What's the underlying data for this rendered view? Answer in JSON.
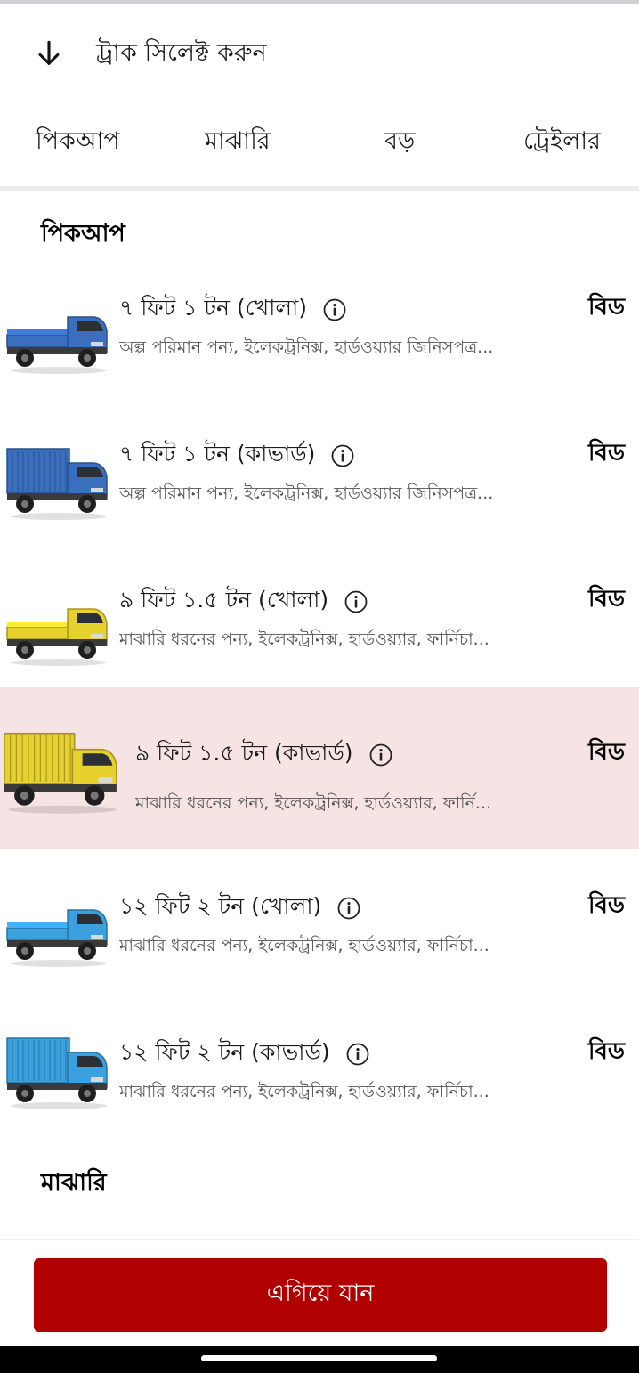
{
  "header": {
    "title": "ট্রাক সিলেক্ট করুন",
    "back_icon": "arrow-down-icon"
  },
  "tabs": [
    {
      "label": "পিকআপ",
      "active": true
    },
    {
      "label": "মাঝারি",
      "active": false
    },
    {
      "label": "বড়",
      "active": false
    },
    {
      "label": "ট্রেইলার",
      "active": false
    }
  ],
  "colors": {
    "accent": "#c8102e",
    "button": "#b00000",
    "selected_row": "#f6e4e4"
  },
  "sections": [
    {
      "title": "পিকআপ",
      "items": [
        {
          "title": "৭ ফিট ১ টন (খোলা)",
          "desc": "অল্প পরিমান পন্য, ইলেকট্রনিক্স, হার্ডওয়্যার জিনিসপত্র...",
          "action": "বিড",
          "truck_color": "#3a6fc0",
          "truck_type": "open",
          "selected": false
        },
        {
          "title": "৭ ফিট ১ টন (কাভার্ড)",
          "desc": "অল্প পরিমান পন্য, ইলেকট্রনিক্স, হার্ডওয়্যার জিনিসপত্র...",
          "action": "বিড",
          "truck_color": "#3a6fc0",
          "truck_type": "covered",
          "selected": false
        },
        {
          "title": "৯ ফিট ১.৫ টন (খোলা)",
          "desc": "মাঝারি ধরনের পন্য, ইলেকট্রনিক্স, হার্ডওয়্যার, ফার্নিচা...",
          "action": "বিড",
          "truck_color": "#e6d12e",
          "truck_type": "open",
          "selected": false
        },
        {
          "title": "৯ ফিট ১.৫ টন (কাভার্ড)",
          "desc": "মাঝারি ধরনের পন্য, ইলেকট্রনিক্স, হার্ডওয়্যার, ফার্নি...",
          "action": "বিড",
          "truck_color": "#e6d12e",
          "truck_type": "covered",
          "selected": true
        },
        {
          "title": "১২ ফিট ২ টন (খোলা)",
          "desc": "মাঝারি ধরনের পন্য, ইলেকট্রনিক্স, হার্ডওয়্যার, ফার্নিচা...",
          "action": "বিড",
          "truck_color": "#3aa0e0",
          "truck_type": "open",
          "selected": false
        },
        {
          "title": "১২ ফিট ২ টন (কাভার্ড)",
          "desc": "মাঝারি ধরনের পন্য, ইলেকট্রনিক্স, হার্ডওয়্যার, ফার্নিচা...",
          "action": "বিড",
          "truck_color": "#3aa0e0",
          "truck_type": "covered",
          "selected": false
        }
      ]
    },
    {
      "title": "মাঝারি",
      "items": []
    }
  ],
  "footer": {
    "continue_label": "এগিয়ে যান"
  }
}
